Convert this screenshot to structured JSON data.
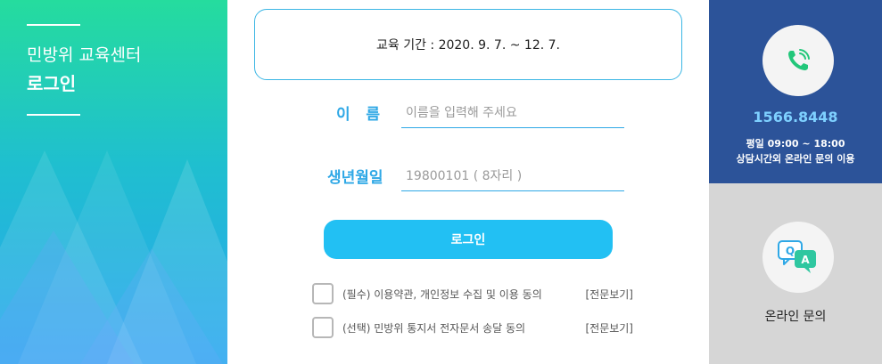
{
  "sidebar": {
    "title": "민방위 교육센터",
    "subtitle": "로그인"
  },
  "form": {
    "period_text": "교육 기간 : 2020. 9. 7. ~ 12. 7.",
    "name_label": "이   름",
    "name_placeholder": "이름을 입력해 주세요",
    "birth_label": "생년월일",
    "birth_placeholder": "19800101 ( 8자리 )",
    "login_label": "로그인",
    "agreements": [
      {
        "text": "(필수) 이용약관, 개인정보 수집 및 이용 동의",
        "link": "[전문보기]"
      },
      {
        "text": "(선택) 민방위 통지서 전자문서 송달 동의",
        "link": "[전문보기]"
      }
    ]
  },
  "contact": {
    "phone_icon": "phone-icon",
    "phone_number": "1566.8448",
    "hours_line1": "평일 09:00 ~ 18:00",
    "hours_line2": "상담시간외 온라인 문의 이용"
  },
  "online": {
    "qa_icon": "qa-chat-icon",
    "label": "온라인 문의"
  },
  "colors": {
    "accent": "#22c0f3",
    "label": "#2fa8e6",
    "contact_bg": "#2c5399",
    "online_bg": "#d6d6d6"
  }
}
